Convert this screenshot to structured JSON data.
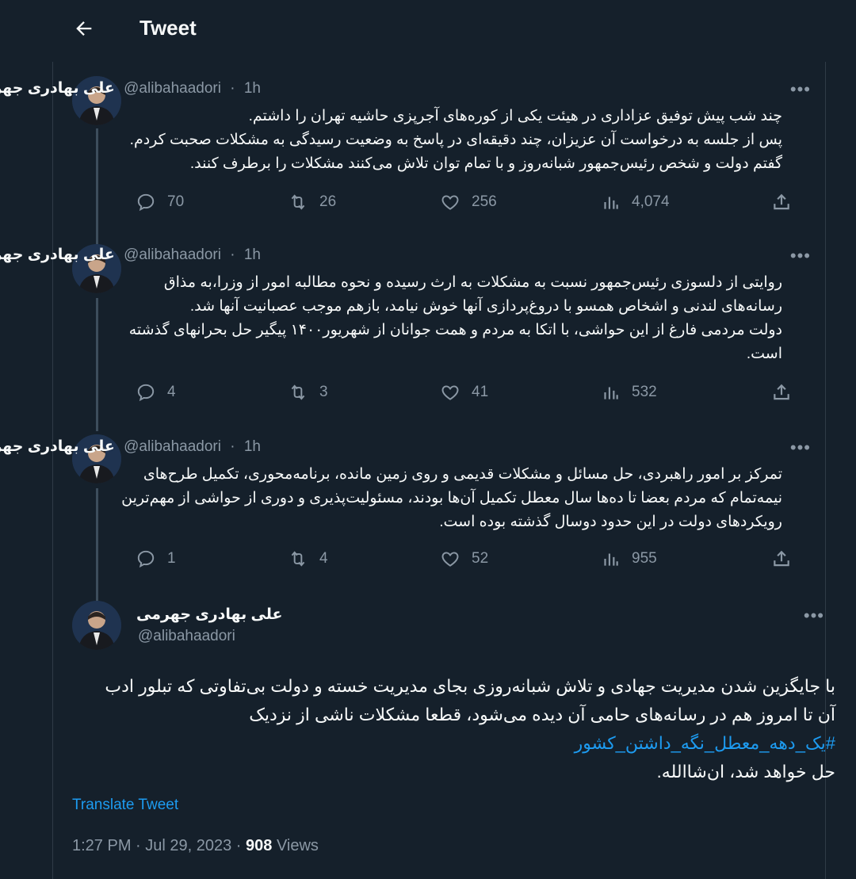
{
  "header": {
    "title": "Tweet",
    "back_icon": "arrow-left-icon"
  },
  "author": {
    "name": "علی بهادری جهرمی",
    "handle": "@alibahaadori"
  },
  "thread": [
    {
      "time": "1h",
      "text": "چند شب پیش توفیق عزاداری در هیئت یکی از کوره‌های آجرپزی حاشیه تهران را داشتم.\nپس از جلسه به درخواست آن عزیزان، چند دقیقه‌ای در پاسخ به وضعیت رسیدگی به مشکلات صحبت کردم. گفتم دولت و شخص رئیس‌جمهور شبانه‌روز و با تمام توان تلاش می‌کنند مشکلات را برطرف کنند.",
      "replies": "70",
      "retweets": "26",
      "likes": "256",
      "views": "4,074"
    },
    {
      "time": "1h",
      "text": "روایتی از دلسوزی رئیس‌جمهور نسبت به مشکلات به ارث رسیده و نحوه مطالبه امور از وزرا،به مذاق رسانه‌های لندنی و اشخاص همسو با دروغ‌پردازی آنها خوش نیامد، بازهم موجب عصبانیت آنها شد.\nدولت مردمی فارغ از این حواشی، با اتکا به مردم و همت جوانان از شهریور۱۴۰۰ پیگیر حل بحرانهای گذشته است.",
      "replies": "4",
      "retweets": "3",
      "likes": "41",
      "views": "532"
    },
    {
      "time": "1h",
      "text": "تمرکز بر امور راهبردی، حل مسائل و مشکلات قدیمی و روی زمین مانده، برنامه‌محوری، تکمیل طرح‌های نیمه‌تمام که مردم بعضا تا ده‌ها سال معطل تکمیل آن‌ها بودند، مسئولیت‌پذیری و دوری از حواشی از مهم‌ترین رویکردهای دولت در این حدود دوسال گذشته بوده است.",
      "replies": "1",
      "retweets": "4",
      "likes": "52",
      "views": "955"
    }
  ],
  "main": {
    "text_part1": "با جایگزین شدن مدیریت جهادی و تلاش شبانه‌روزی بجای مدیریت خسته و دولت بی‌تفاوتی که تبلور ادب آن تا امروز هم در رسانه‌های حامی آن دیده می‌شود، قطعا مشکلات ناشی از نزدیک",
    "hashtag": "#یک_دهه_معطل_نگه_داشتن_کشور",
    "text_part2": "حل خواهد شد، ان‌شاالله.",
    "translate": "Translate Tweet",
    "time": "1:27 PM · Jul 29, 2023 · ",
    "views_count": "908",
    "views_label": " Views"
  },
  "separator": "·",
  "more_glyph": "•••",
  "colors": {
    "background": "#15202b",
    "accent": "#1d9bf0",
    "muted": "#8b98a5",
    "text": "#f7f9f9"
  }
}
